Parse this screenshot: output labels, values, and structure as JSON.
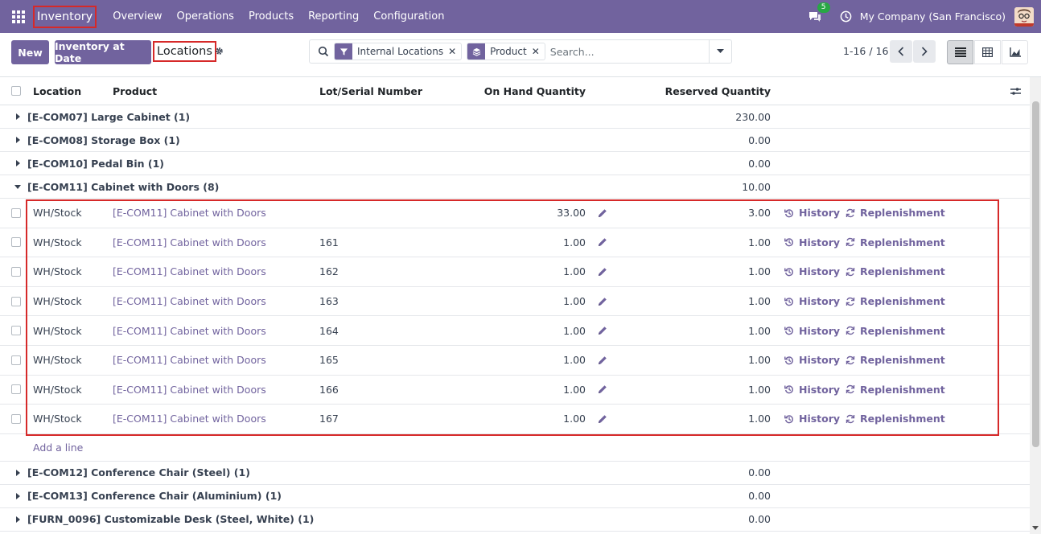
{
  "navbar": {
    "brand": "Inventory",
    "menu": [
      "Overview",
      "Operations",
      "Products",
      "Reporting",
      "Configuration"
    ],
    "chat_count": "5",
    "company": "My Company (San Francisco)"
  },
  "control": {
    "new_label": "New",
    "inventory_date_label": "Inventory at Date",
    "breadcrumb": "Locations",
    "search": {
      "facets": [
        {
          "icon": "filter-icon",
          "label": "Internal Locations"
        },
        {
          "icon": "layers-icon",
          "label": "Product"
        }
      ],
      "placeholder": "Search..."
    },
    "pager": "1-16 / 16"
  },
  "table": {
    "headers": {
      "location": "Location",
      "product": "Product",
      "lot": "Lot/Serial Number",
      "on_hand": "On Hand Quantity",
      "reserved": "Reserved Quantity"
    },
    "groups_before": [
      {
        "label": "[E-COM07] Large Cabinet (1)",
        "reserved": "230.00"
      },
      {
        "label": "[E-COM08] Storage Box (1)",
        "reserved": "0.00"
      },
      {
        "label": "[E-COM10] Pedal Bin (1)",
        "reserved": "0.00"
      }
    ],
    "open_group": {
      "label": "[E-COM11] Cabinet with Doors (8)",
      "reserved": "10.00"
    },
    "rows": [
      {
        "location": "WH/Stock",
        "product": "[E-COM11] Cabinet with Doors",
        "lot": "",
        "on_hand": "33.00",
        "reserved": "3.00"
      },
      {
        "location": "WH/Stock",
        "product": "[E-COM11] Cabinet with Doors",
        "lot": "161",
        "on_hand": "1.00",
        "reserved": "1.00"
      },
      {
        "location": "WH/Stock",
        "product": "[E-COM11] Cabinet with Doors",
        "lot": "162",
        "on_hand": "1.00",
        "reserved": "1.00"
      },
      {
        "location": "WH/Stock",
        "product": "[E-COM11] Cabinet with Doors",
        "lot": "163",
        "on_hand": "1.00",
        "reserved": "1.00"
      },
      {
        "location": "WH/Stock",
        "product": "[E-COM11] Cabinet with Doors",
        "lot": "164",
        "on_hand": "1.00",
        "reserved": "1.00"
      },
      {
        "location": "WH/Stock",
        "product": "[E-COM11] Cabinet with Doors",
        "lot": "165",
        "on_hand": "1.00",
        "reserved": "1.00"
      },
      {
        "location": "WH/Stock",
        "product": "[E-COM11] Cabinet with Doors",
        "lot": "166",
        "on_hand": "1.00",
        "reserved": "1.00"
      },
      {
        "location": "WH/Stock",
        "product": "[E-COM11] Cabinet with Doors",
        "lot": "167",
        "on_hand": "1.00",
        "reserved": "1.00"
      }
    ],
    "history_label": "History",
    "replenishment_label": "Replenishment",
    "add_line": "Add a line",
    "groups_after": [
      {
        "label": "[E-COM12] Conference Chair (Steel) (1)",
        "reserved": "0.00"
      },
      {
        "label": "[E-COM13] Conference Chair (Aluminium) (1)",
        "reserved": "0.00"
      },
      {
        "label": "[FURN_0096] Customizable Desk (Steel, White) (1)",
        "reserved": "0.00"
      }
    ]
  },
  "colors": {
    "brand": "#71639e",
    "highlight": "#d62929"
  }
}
